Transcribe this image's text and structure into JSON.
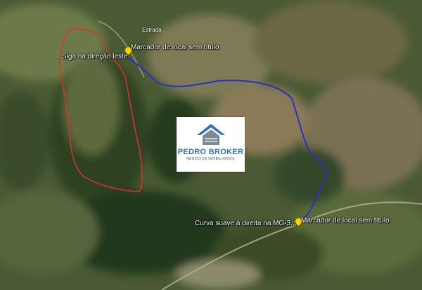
{
  "map": {
    "top_label": "Estrada",
    "labels": {
      "start_instruction": "Siga na direção leste",
      "marker_top": "Marcador de local sem título",
      "turn_instruction": "Curva suave à direita na MG-3...",
      "marker_bottom": "Marcador de local sem título"
    },
    "route_color": "#2b2ec8",
    "property_outline_color": "#e0302a",
    "logo": {
      "name": "PEDRO BROKER",
      "subtitle": "NEGÓCIOS IMOBILIÁRIOS"
    }
  }
}
